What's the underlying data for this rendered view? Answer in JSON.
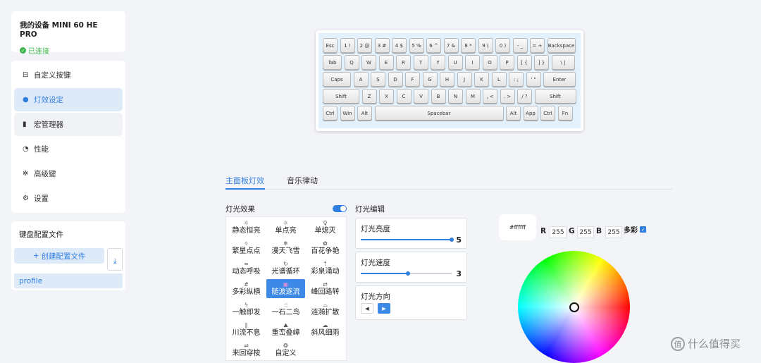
{
  "device": {
    "name": "我的设备 MINI 60 HE PRO",
    "status": "已连接"
  },
  "nav": [
    {
      "label": "自定义按键",
      "icon": "keymap-icon"
    },
    {
      "label": "灯效设定",
      "icon": "bulb-icon"
    },
    {
      "label": "宏管理器",
      "icon": "macro-icon"
    },
    {
      "label": "性能",
      "icon": "gauge-icon"
    },
    {
      "label": "高级键",
      "icon": "advanced-icon"
    },
    {
      "label": "设置",
      "icon": "gear-icon"
    }
  ],
  "config": {
    "title": "键盘配置文件",
    "create_label": "创建配置文件",
    "profile": "profile"
  },
  "keyboard": {
    "row1": [
      "Esc",
      "1 !",
      "2 @",
      "3 #",
      "4 $",
      "5 %",
      "6 ^",
      "7 &",
      "8 *",
      "9 (",
      "0 )",
      "- _",
      "= +",
      "Backspace"
    ],
    "row2": [
      "Tab",
      "Q",
      "W",
      "E",
      "R",
      "T",
      "Y",
      "U",
      "I",
      "O",
      "P",
      "[ {",
      "] }",
      "\\ |"
    ],
    "row3": [
      "Caps",
      "A",
      "S",
      "D",
      "F",
      "G",
      "H",
      "J",
      "K",
      "L",
      ": ;",
      "' \"",
      "Enter"
    ],
    "row4": [
      "Shift",
      "Z",
      "X",
      "C",
      "V",
      "B",
      "N",
      "M",
      ", <",
      ". >",
      "/ ?",
      "Shift"
    ],
    "row5": [
      "Ctrl",
      "Win",
      "Alt",
      "Spacebar",
      "Alt",
      "App",
      "Ctrl",
      "Fn"
    ]
  },
  "tabs": [
    "主面板灯效",
    "音乐律动"
  ],
  "effects": {
    "title": "灯光效果",
    "items": [
      {
        "label": "静态恒亮",
        "icon": "☼"
      },
      {
        "label": "单点亮",
        "icon": "☼"
      },
      {
        "label": "单熄灭",
        "icon": "♀"
      },
      {
        "label": "繁星点点",
        "icon": "✧"
      },
      {
        "label": "漫天飞雪",
        "icon": "❄"
      },
      {
        "label": "百花争艳",
        "icon": "✿"
      },
      {
        "label": "动态呼吸",
        "icon": "≈"
      },
      {
        "label": "光谱循环",
        "icon": "↻"
      },
      {
        "label": "彩泉涌动",
        "icon": "⇡"
      },
      {
        "label": "多彩纵横",
        "icon": "#"
      },
      {
        "label": "随波逐流",
        "icon": "▣"
      },
      {
        "label": "峰回路转",
        "icon": "⇄"
      },
      {
        "label": "一触即发",
        "icon": "ϟ"
      },
      {
        "label": "一石二鸟",
        "icon": "☝"
      },
      {
        "label": "涟漪扩散",
        "icon": "⌓"
      },
      {
        "label": "川流不息",
        "icon": "∥"
      },
      {
        "label": "重峦叠嶂",
        "icon": "⛰"
      },
      {
        "label": "斜风细雨",
        "icon": "☁"
      },
      {
        "label": "来回穿梭",
        "icon": "⇌"
      },
      {
        "label": "自定义",
        "icon": "❂"
      }
    ],
    "selected_index": 10
  },
  "editor": {
    "title": "灯光编辑",
    "brightness": {
      "label": "灯光亮度",
      "value": 5,
      "fraction": 1.0
    },
    "speed": {
      "label": "灯光速度",
      "value": 3,
      "fraction": 0.52
    },
    "direction": {
      "label": "灯光方向"
    }
  },
  "color": {
    "hex": "#ffffff",
    "r_label": "R",
    "r": "255",
    "g_label": "G",
    "g": "255",
    "b_label": "B",
    "b": "255",
    "multi_label": "多彩"
  },
  "watermark": "什么值得买"
}
